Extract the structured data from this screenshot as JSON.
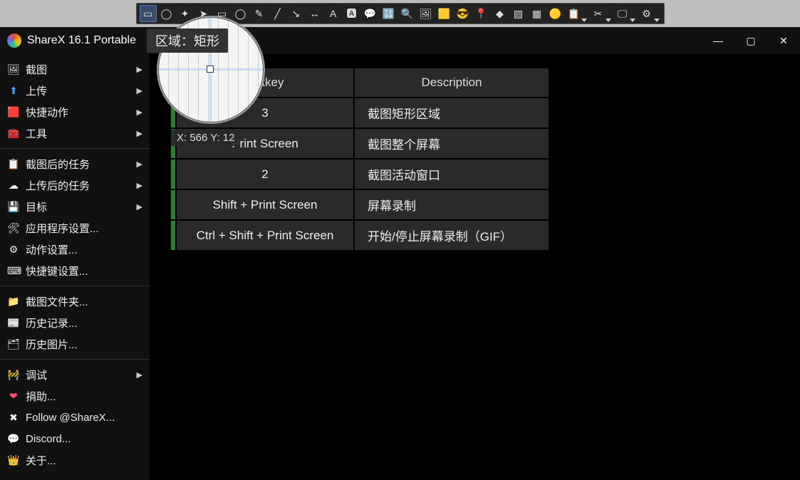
{
  "toolbar": {
    "icons": [
      {
        "name": "region-rect-icon",
        "glyph": "▭",
        "active": true
      },
      {
        "name": "region-ellipse-icon",
        "glyph": "◯"
      },
      {
        "name": "region-freehand-icon",
        "glyph": "✦"
      },
      {
        "name": "cursor-icon",
        "glyph": "➤"
      },
      {
        "name": "shape-rect-icon",
        "glyph": "▭"
      },
      {
        "name": "shape-ellipse-icon",
        "glyph": "◯"
      },
      {
        "name": "pen-icon",
        "glyph": "✎"
      },
      {
        "name": "line-icon",
        "glyph": "╱"
      },
      {
        "name": "arrow-icon",
        "glyph": "↘"
      },
      {
        "name": "double-arrow-icon",
        "glyph": "↔"
      },
      {
        "name": "text-a-icon",
        "glyph": "A"
      },
      {
        "name": "text-box-icon",
        "glyph": "🅰"
      },
      {
        "name": "speech-icon",
        "glyph": "💬"
      },
      {
        "name": "step-icon",
        "glyph": "🔢"
      },
      {
        "name": "magnify-icon",
        "glyph": "🔍"
      },
      {
        "name": "image-icon",
        "glyph": "🖼"
      },
      {
        "name": "sticker-icon",
        "glyph": "🟨"
      },
      {
        "name": "emoji-icon",
        "glyph": "😎"
      },
      {
        "name": "pin-icon",
        "glyph": "📍"
      },
      {
        "name": "eraser-icon",
        "glyph": "◆"
      },
      {
        "name": "blur-icon",
        "glyph": "▨"
      },
      {
        "name": "pixelate-icon",
        "glyph": "▦"
      },
      {
        "name": "highlight-icon",
        "glyph": "🟡"
      },
      {
        "name": "crop-dd-icon",
        "glyph": "📋",
        "dropdown": true
      },
      {
        "name": "tools-dd-icon",
        "glyph": "✂",
        "dropdown": true
      },
      {
        "name": "view-dd-icon",
        "glyph": "🖵",
        "dropdown": true
      },
      {
        "name": "settings-dd-icon",
        "glyph": "⚙",
        "dropdown": true
      }
    ]
  },
  "titlebar": {
    "title": "ShareX 16.1 Portable"
  },
  "sidebar": {
    "groups": [
      [
        {
          "icon": "🖼",
          "label": "截图",
          "sub": true,
          "name": "menu-capture"
        },
        {
          "icon": "⬆",
          "label": "上传",
          "sub": true,
          "name": "menu-upload",
          "iconColor": "#4aa3ff"
        },
        {
          "icon": "🟥",
          "label": "快捷动作",
          "sub": true,
          "name": "menu-workflows"
        },
        {
          "icon": "🧰",
          "label": "工具",
          "sub": true,
          "name": "menu-tools"
        }
      ],
      [
        {
          "icon": "📋",
          "label": "截图后的任务",
          "sub": true,
          "name": "menu-after-capture"
        },
        {
          "icon": "☁",
          "label": "上传后的任务",
          "sub": true,
          "name": "menu-after-upload"
        },
        {
          "icon": "💾",
          "label": "目标",
          "sub": true,
          "name": "menu-destinations"
        },
        {
          "icon": "🛠",
          "label": "应用程序设置...",
          "name": "menu-app-settings"
        },
        {
          "icon": "⚙",
          "label": "动作设置...",
          "name": "menu-task-settings"
        },
        {
          "icon": "⌨",
          "label": "快捷键设置...",
          "name": "menu-hotkey-settings"
        }
      ],
      [
        {
          "icon": "📁",
          "label": "截图文件夹...",
          "name": "menu-screenshots-folder"
        },
        {
          "icon": "📰",
          "label": "历史记录...",
          "name": "menu-history"
        },
        {
          "icon": "🗂",
          "label": "历史图片...",
          "name": "menu-image-history"
        }
      ],
      [
        {
          "icon": "🚧",
          "label": "调试",
          "sub": true,
          "name": "menu-debug"
        },
        {
          "icon": "❤",
          "label": "捐助...",
          "name": "menu-donate",
          "iconColor": "#ff4d6d"
        },
        {
          "icon": "✖",
          "label": "Follow @ShareX...",
          "name": "menu-follow"
        },
        {
          "icon": "💬",
          "label": "Discord...",
          "name": "menu-discord"
        },
        {
          "icon": "👑",
          "label": "关于...",
          "name": "menu-about"
        }
      ]
    ]
  },
  "hotkeys": {
    "header_hotkey": "Hotkey",
    "header_desc": "Description",
    "rows": [
      {
        "hk": "3",
        "desc": "截图矩形区域"
      },
      {
        "hk": "Print Screen",
        "desc": "截图整个屏幕",
        "partial": "nt Screen"
      },
      {
        "hk": "2",
        "desc": "截图活动窗口"
      },
      {
        "hk": "Shift + Print Screen",
        "desc": "屏幕录制"
      },
      {
        "hk": "Ctrl + Shift + Print Screen",
        "desc": "开始/停止屏幕录制（GIF）"
      }
    ]
  },
  "magnifier": {
    "tooltip": "区域：矩形",
    "coords": "X: 566 Y: 12"
  }
}
